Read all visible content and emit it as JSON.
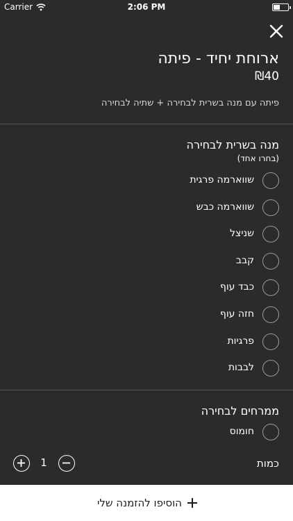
{
  "status_bar": {
    "carrier": "Carrier",
    "time": "2:06 PM",
    "wifi_icon": "wifi-icon",
    "battery_icon": "battery-icon"
  },
  "header": {
    "close_icon": "close-icon",
    "title": "ארוחת יחיד - פיתה",
    "price": "₪40",
    "description": "פיתה עם מנה בשרית לבחירה + שתיה לבחירה"
  },
  "meat_section": {
    "title": "מנה בשרית לבחירה",
    "subtitle": "(בחרו אחד)",
    "options": [
      {
        "label": "שווארמה פרגית",
        "selected": false
      },
      {
        "label": "שווארמה כבש",
        "selected": false
      },
      {
        "label": "שניצל",
        "selected": false
      },
      {
        "label": "קבב",
        "selected": false
      },
      {
        "label": "כבד עוף",
        "selected": false
      },
      {
        "label": "חזה עוף",
        "selected": false
      },
      {
        "label": "פרגיות",
        "selected": false
      },
      {
        "label": "לבבות",
        "selected": false
      }
    ]
  },
  "spreads_section": {
    "title": "ממרחים לבחירה",
    "options": [
      {
        "label": "חומוס",
        "selected": false
      }
    ]
  },
  "quantity": {
    "label": "כמות",
    "value": "1",
    "plus_icon": "plus-circle-icon",
    "minus_icon": "minus-circle-icon"
  },
  "footer": {
    "add_label": "הוסיפו להזמנה שלי",
    "add_icon": "plus-icon"
  },
  "colors": {
    "background": "#2b2b2b",
    "text": "#ffffff",
    "radio_border": "#9a9a9a",
    "footer_background": "#ffffff"
  }
}
